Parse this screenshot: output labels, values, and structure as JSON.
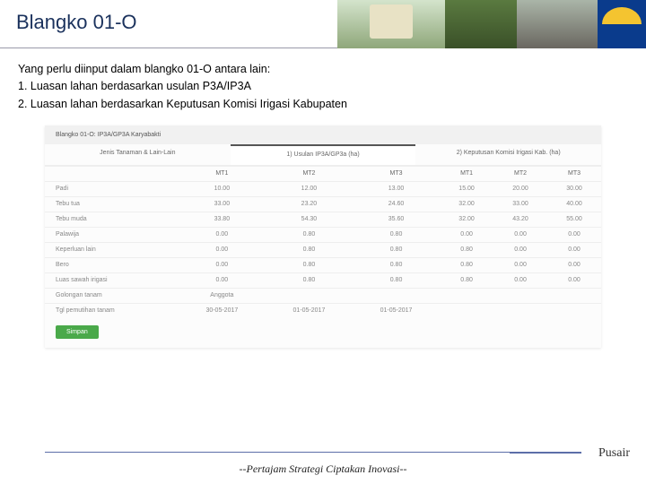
{
  "header": {
    "title": "Blangko 01-O"
  },
  "intro": {
    "lead": "Yang perlu diinput dalam blangko 01-O antara lain:",
    "item1": "1.   Luasan lahan berdasarkan usulan P3A/IP3A",
    "item2": "2.   Luasan lahan berdasarkan Keputusan Komisi Irigasi Kabupaten"
  },
  "screenshot": {
    "title": "Blangko 01-O: IP3A/GP3A Karyabakti",
    "tab1": "Jenis Tanaman & Lain-Lain",
    "tab2": "1) Usulan IP3A/GP3a (ha)",
    "tab3": "2) Keputusan Komisi Irigasi Kab. (ha)",
    "cols": {
      "c1": "MT1",
      "c2": "MT2",
      "c3": "MT3",
      "c4": "MT1",
      "c5": "MT2",
      "c6": "MT3"
    },
    "rows": [
      {
        "label": "Padi",
        "v": [
          "10.00",
          "12.00",
          "13.00",
          "15.00",
          "20.00",
          "30.00"
        ]
      },
      {
        "label": "Tebu tua",
        "v": [
          "33.00",
          "23.20",
          "24.60",
          "32.00",
          "33.00",
          "40.00"
        ]
      },
      {
        "label": "Tebu muda",
        "v": [
          "33.80",
          "54.30",
          "35.60",
          "32.00",
          "43.20",
          "55.00"
        ]
      },
      {
        "label": "Palawija",
        "v": [
          "0.00",
          "0.80",
          "0.80",
          "0.00",
          "0.00",
          "0.00"
        ]
      },
      {
        "label": "Keperluan lain",
        "v": [
          "0.00",
          "0.80",
          "0.80",
          "0.80",
          "0.00",
          "0.00"
        ]
      },
      {
        "label": "Bero",
        "v": [
          "0.00",
          "0.80",
          "0.80",
          "0.80",
          "0.00",
          "0.00"
        ]
      },
      {
        "label": "Luas sawah irigasi",
        "v": [
          "0.00",
          "0.80",
          "0.80",
          "0.80",
          "0.00",
          "0.00"
        ]
      },
      {
        "label": "Golongan tanam",
        "v": [
          "Anggota",
          "",
          "",
          "",
          "",
          ""
        ]
      },
      {
        "label": "Tgl pemutihan tanam",
        "v": [
          "30-05-2017",
          "01-05-2017",
          "01-05-2017",
          "",
          "",
          ""
        ]
      }
    ],
    "save": "Simpan"
  },
  "footer": {
    "brand": "Pusair",
    "tagline": "--Pertajam Strategi Ciptakan Inovasi--"
  }
}
